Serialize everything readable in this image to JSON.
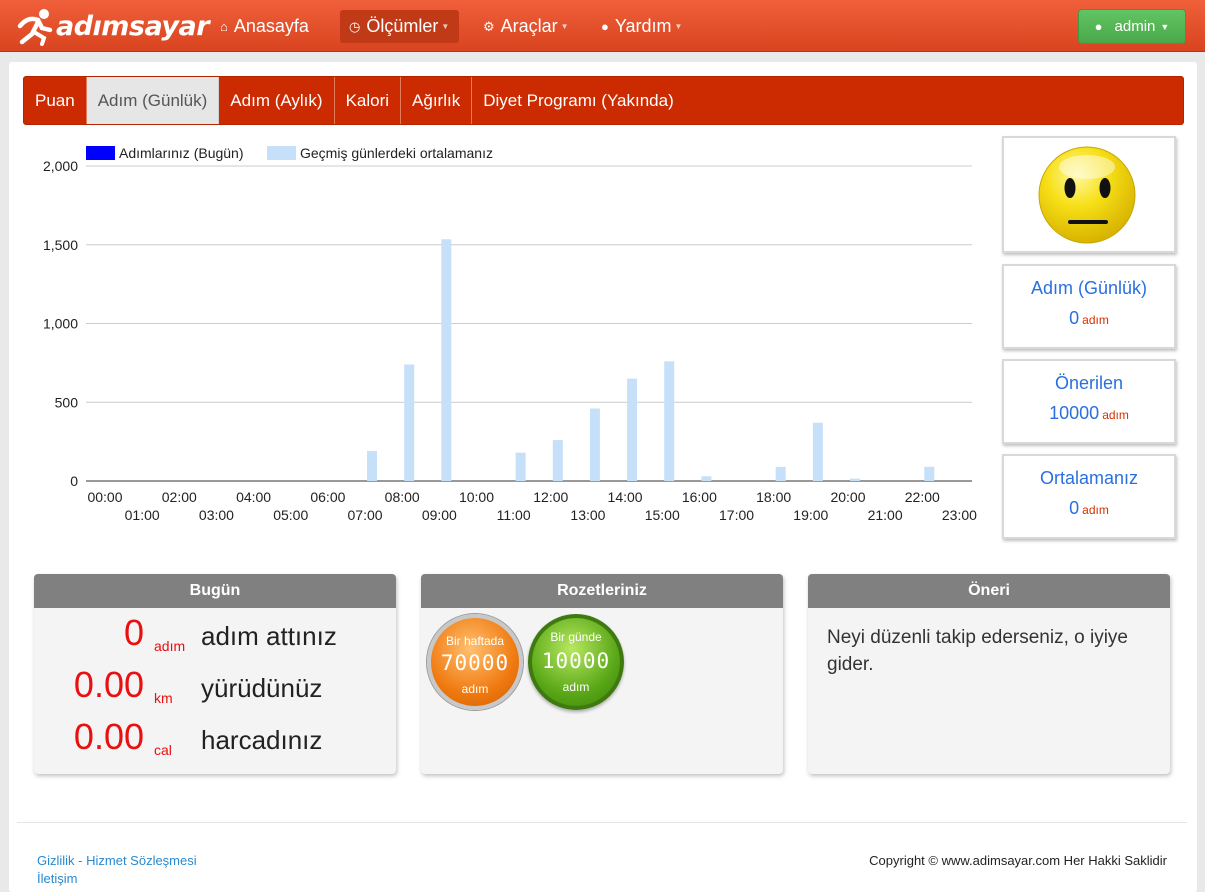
{
  "brand": {
    "name": "adımsayar"
  },
  "navbar": {
    "items": [
      {
        "label": "Anasayfa",
        "icon": "home-icon",
        "active": false
      },
      {
        "label": "Ölçümler",
        "icon": "clock-icon",
        "active": true
      },
      {
        "label": "Araçlar",
        "icon": "gear-icon",
        "active": false
      },
      {
        "label": "Yardım",
        "icon": "user-icon",
        "active": false
      }
    ],
    "user_label": "admin"
  },
  "tabs": [
    {
      "label": "Puan"
    },
    {
      "label": "Adım (Günlük)"
    },
    {
      "label": "Adım (Aylık)"
    },
    {
      "label": "Kalori"
    },
    {
      "label": "Ağırlık"
    },
    {
      "label": "Diyet Programı (Yakında)"
    }
  ],
  "chart_data": {
    "type": "bar",
    "categories": [
      "00:00",
      "01:00",
      "02:00",
      "03:00",
      "04:00",
      "05:00",
      "06:00",
      "07:00",
      "08:00",
      "09:00",
      "10:00",
      "11:00",
      "12:00",
      "13:00",
      "14:00",
      "15:00",
      "16:00",
      "17:00",
      "18:00",
      "19:00",
      "20:00",
      "21:00",
      "22:00",
      "23:00"
    ],
    "series": [
      {
        "name": "Adımlarınız (Bugün)",
        "color": "#0000ff",
        "values": [
          0,
          0,
          0,
          0,
          0,
          0,
          0,
          0,
          0,
          0,
          0,
          0,
          0,
          0,
          0,
          0,
          0,
          0,
          0,
          0,
          0,
          0,
          0,
          0
        ]
      },
      {
        "name": "Geçmiş günlerdeki ortalamanız",
        "color": "#c6e0fa",
        "values": [
          0,
          0,
          0,
          0,
          0,
          0,
          0,
          190,
          740,
          1535,
          0,
          180,
          260,
          460,
          650,
          760,
          30,
          0,
          90,
          370,
          15,
          0,
          90,
          0
        ]
      }
    ],
    "yticks": [
      "0",
      "500",
      "1,000",
      "1,500",
      "2,000"
    ],
    "ylim": [
      0,
      2000
    ],
    "legend": "top-left",
    "grid": true
  },
  "side": {
    "mood_icon": "neutral-face-icon",
    "daily": {
      "title": "Adım (Günlük)",
      "value": "0",
      "unit": "adım"
    },
    "recommended": {
      "title": "Önerilen",
      "value": "10000",
      "unit": "adım"
    },
    "average": {
      "title": "Ortalamanız",
      "value": "0",
      "unit": "adım"
    }
  },
  "today": {
    "title": "Bugün",
    "rows": [
      {
        "value": "0",
        "unit": "adım",
        "text": "adım attınız"
      },
      {
        "value": "0.00",
        "unit": "km",
        "text": "yürüdünüz"
      },
      {
        "value": "0.00",
        "unit": "cal",
        "text": "harcadınız"
      }
    ]
  },
  "badges": {
    "title": "Rozetleriniz",
    "items": [
      {
        "line1": "Bir haftada",
        "number": "70000",
        "unit": "adım",
        "color": "#f08a1c"
      },
      {
        "line1": "Bir günde",
        "number": "10000",
        "unit": "adım",
        "color": "#5aa818"
      }
    ]
  },
  "advice": {
    "title": "Öneri",
    "text": "Neyi düzenli takip ederseniz, o iyiye gider."
  },
  "footer": {
    "links": [
      "Gizlilik - Hizmet Sözleşmesi",
      "İletişim"
    ],
    "copyright": "Copyright © www.adimsayar.com Her Hakki Saklidir"
  }
}
